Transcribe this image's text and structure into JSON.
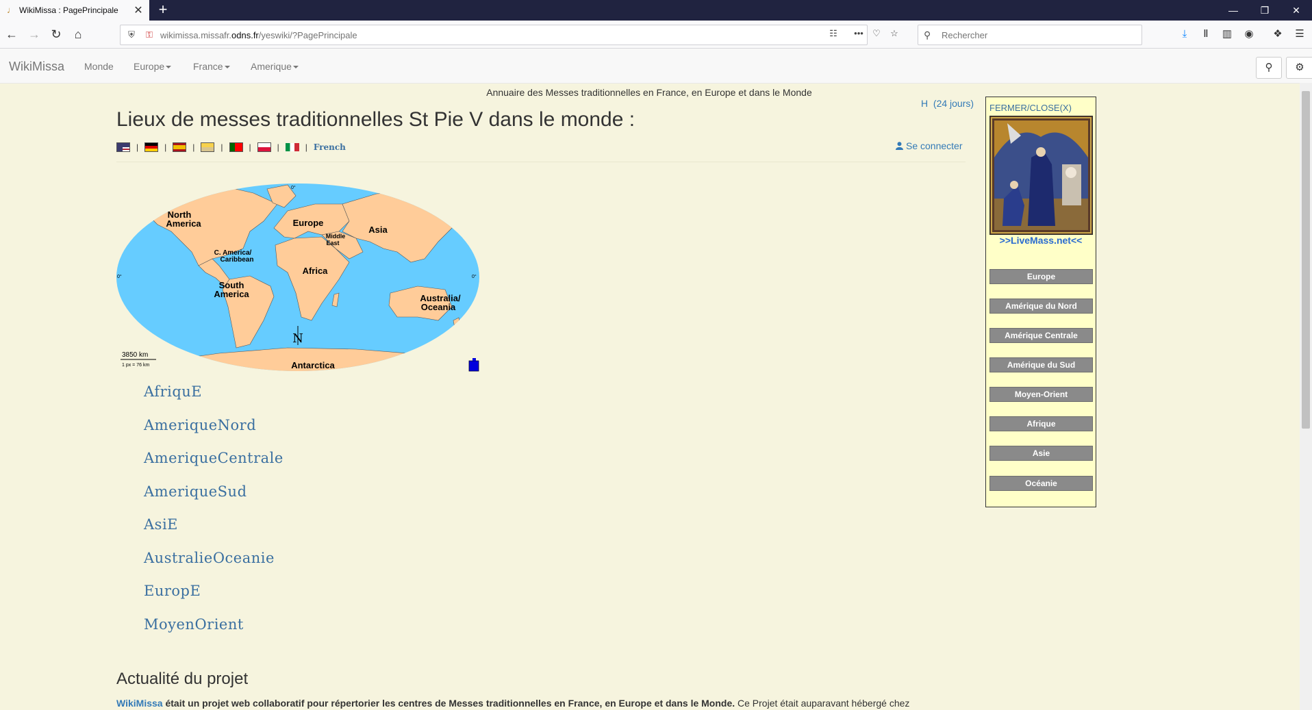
{
  "browser": {
    "tab_title": "WikiMissa : PagePrincipale",
    "url_domain_pre": "wikimissa.missafr.",
    "url_domain": "odns.fr",
    "url_path": "/yeswiki/?PagePrincipale",
    "search_placeholder": "Rechercher"
  },
  "sitenav": {
    "brand": "WikiMissa",
    "items": [
      {
        "label": "Monde"
      },
      {
        "label": "Europe"
      },
      {
        "label": "France"
      },
      {
        "label": "Amerique"
      }
    ]
  },
  "content": {
    "annuaire": "Annuaire des Messes traditionnelles en France, en Europe et dans le Monde",
    "title": "Lieux de messes traditionnelles St Pie V dans le monde :",
    "language_link": "French",
    "history_letter": "H",
    "history_days": "(24 jours)",
    "login": "Se connecter",
    "map": {
      "labels": {
        "north_america_1": "North",
        "north_america_2": "America",
        "europe": "Europe",
        "asia": "Asia",
        "middle_east_1": "Middle",
        "middle_east_2": "East",
        "caribbean_1": "C. America/",
        "caribbean_2": "Caribbean",
        "africa": "Africa",
        "south_america_1": "South",
        "south_america_2": "America",
        "australia_1": "Australia/",
        "australia_2": "Oceania",
        "antarctica": "Antarctica",
        "north": "N",
        "scale": "3850 km",
        "scale_px": "1 px = 76 km",
        "deg_top": "0°",
        "deg_left": "0°",
        "deg_right": "0°"
      }
    },
    "regions": [
      "AfriquE",
      "AmeriqueNord",
      "AmeriqueCentrale",
      "AmeriqueSud",
      "AsiE",
      "AustralieOceanie",
      "EuropE",
      "MoyenOrient"
    ],
    "actu_heading": "Actualité du projet",
    "para_link": "WikiMissa",
    "para_bold": " était un projet web collaboratif pour répertorier les centres de Messes traditionnelles en France, en Europe et dans le Monde.",
    "para_rest": " Ce Projet était auparavant hébergé chez"
  },
  "side": {
    "close": "FERMER/CLOSE(X)",
    "livemass": ">>LiveMass.net<<",
    "buttons": [
      "Europe",
      "Amérique du Nord",
      "Amérique Centrale",
      "Amérique du Sud",
      "Moyen-Orient",
      "Afrique",
      "Asie",
      "Océanie"
    ]
  },
  "colors": {
    "ocean": "#66ccff",
    "land": "#ffcc99",
    "page_bg": "#f6f4de",
    "panel_bg": "#ffffc8",
    "link": "#337ab7"
  }
}
